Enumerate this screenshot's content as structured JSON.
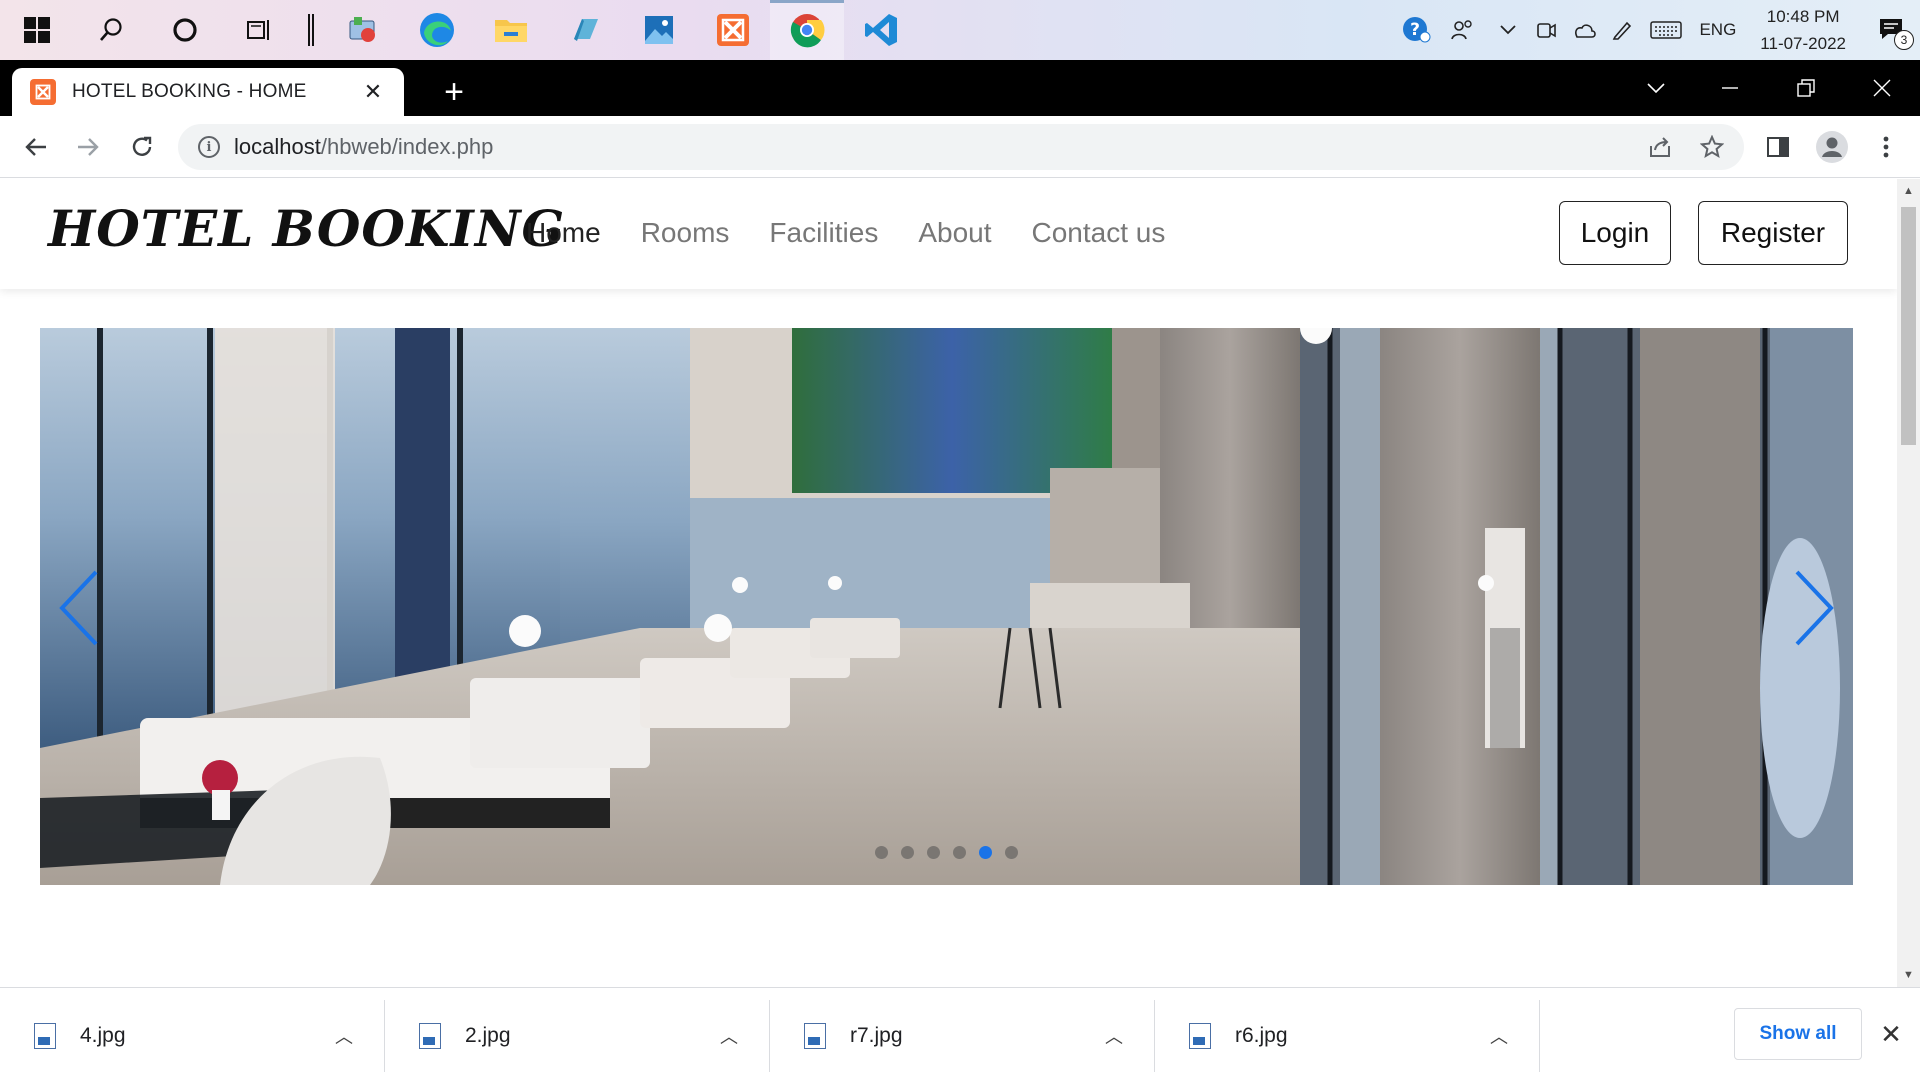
{
  "taskbar": {
    "apps": [
      "windows-start",
      "search",
      "cortana",
      "task-view",
      "separator",
      "control-panel",
      "edge",
      "file-explorer",
      "notepad",
      "photos",
      "xampp",
      "chrome",
      "vscode"
    ],
    "active_app": "chrome",
    "tray": {
      "language": "ENG",
      "time": "10:48 PM",
      "date": "11-07-2022",
      "notification_count": "3"
    }
  },
  "browser": {
    "tab_title": "HOTEL BOOKING - HOME",
    "new_tab_label": "+",
    "url_host": "localhost",
    "url_path": "/hbweb/index.php"
  },
  "site": {
    "brand": "HOTEL BOOKING",
    "menu": [
      {
        "label": "Home",
        "active": true
      },
      {
        "label": "Rooms",
        "active": false
      },
      {
        "label": "Facilities",
        "active": false
      },
      {
        "label": "About",
        "active": false
      },
      {
        "label": "Contact us",
        "active": false
      }
    ],
    "login_label": "Login",
    "register_label": "Register",
    "carousel": {
      "slide_count": 6,
      "active_slide": 5
    }
  },
  "downloads": {
    "items": [
      {
        "name": "4.jpg"
      },
      {
        "name": "2.jpg"
      },
      {
        "name": "r7.jpg"
      },
      {
        "name": "r6.jpg"
      }
    ],
    "show_all_label": "Show all"
  },
  "colors": {
    "accent": "#1a73e8",
    "xampp": "#f56d32"
  }
}
